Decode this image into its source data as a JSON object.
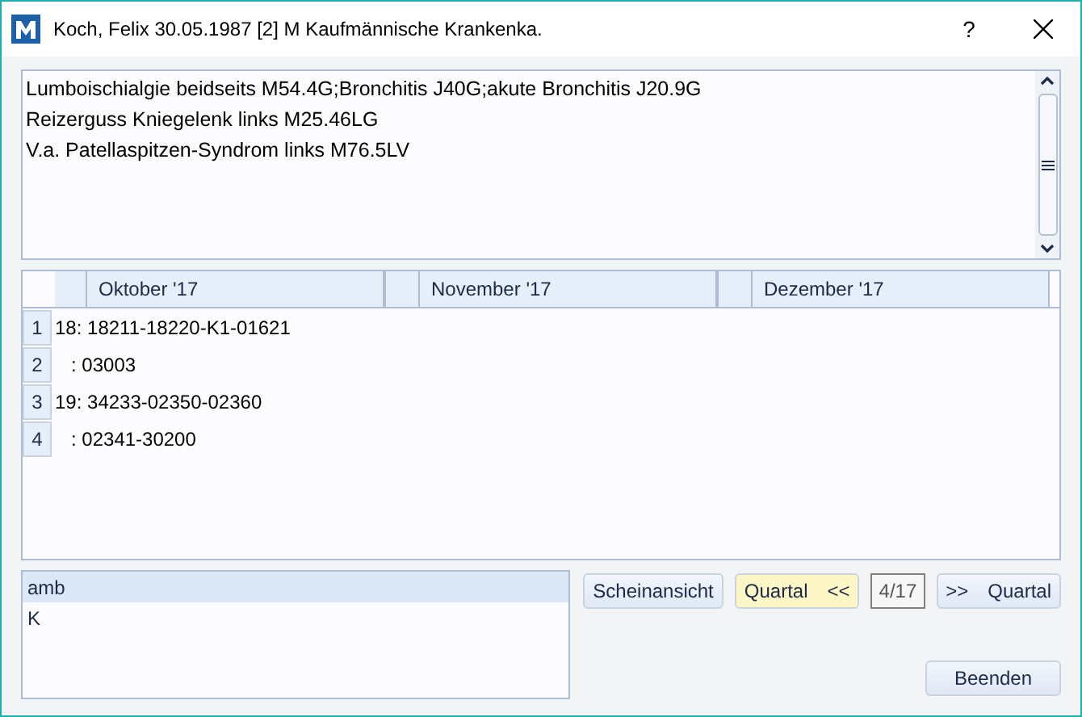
{
  "window": {
    "title": "Koch, Felix 30.05.1987  [2]  M Kaufmännische Krankenka.",
    "help": "?"
  },
  "diagnoses": [
    "Lumboischialgie beidseits M54.4G;Bronchitis J40G;akute Bronchitis J20.9G",
    "Reizerguss Kniegelenk links M25.46LG",
    "V.a. Patellaspitzen-Syndrom links M76.5LV"
  ],
  "table": {
    "columns": [
      "Oktober '17",
      "November '17",
      "Dezember '17"
    ],
    "rows": [
      {
        "number": "1",
        "text": "18: 18211-18220-K1-01621"
      },
      {
        "number": "2",
        "text": "   : 03003"
      },
      {
        "number": "3",
        "text": "19: 34233-02350-02360"
      },
      {
        "number": "4",
        "text": "   : 02341-30200"
      }
    ]
  },
  "list": [
    {
      "label": "amb",
      "selected": true
    },
    {
      "label": "K",
      "selected": false
    }
  ],
  "buttons": {
    "view": "Scheinansicht",
    "prev": {
      "label": "Quartal",
      "arrows": "<<",
      "highlighted": true
    },
    "quarter": "4/17",
    "next": {
      "label": "Quartal",
      "arrows": ">>",
      "highlighted": false
    },
    "close": "Beenden"
  }
}
